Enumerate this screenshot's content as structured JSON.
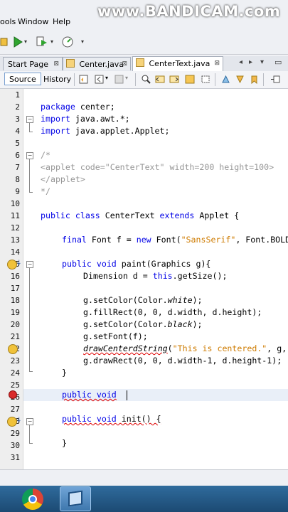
{
  "menu": {
    "items": [
      "ools",
      "Window",
      "Help"
    ]
  },
  "watermark": "www.BANDICAM.com",
  "tabs": [
    {
      "label": "Start Page",
      "close": "⊠"
    },
    {
      "label": "Center.java",
      "close": "⊠"
    },
    {
      "label": "CenterText.java",
      "close": "⊠"
    }
  ],
  "editor_toolbar": {
    "source_label": "Source",
    "history_label": "History"
  },
  "editor": {
    "line_numbers": [
      "1",
      "2",
      "3",
      "4",
      "5",
      "6",
      "7",
      "8",
      "9",
      "10",
      "11",
      "12",
      "13",
      "14",
      "15",
      "16",
      "17",
      "18",
      "19",
      "20",
      "21",
      "22",
      "23",
      "24",
      "25",
      "26",
      "27",
      "28",
      "29",
      "30",
      "31"
    ]
  },
  "code": {
    "l2_kw": "package",
    "l2_rest": " center;",
    "l3_kw": "import",
    "l3_rest": " java.awt.*;",
    "l4_kw": "import",
    "l4_rest": " java.applet.Applet;",
    "l7": "/*",
    "l8": "<applet code=\"CenterText\" width=200 height=100>",
    "l9": "</applet>",
    "l10": "*/",
    "l11_kw1": "public class",
    "l11_mid": " CenterText ",
    "l11_kw2": "extends",
    "l11_rest": " Applet {",
    "l13_kw1": "final",
    "l13_a": " Font f = ",
    "l13_kw2": "new",
    "l13_b": " Font(",
    "l13_str": "\"SansSerif\"",
    "l13_c": ", Font.BOLD",
    "l15_kw": "public void",
    "l15_rest": " paint(Graphics g){",
    "l16_a": "Dimension d = ",
    "l16_kw": "this",
    "l16_b": ".getSize();",
    "l18_a": "g.setColor(Color.",
    "l18_it": "white",
    "l18_b": ");",
    "l19": "g.fillRect(0, 0, d.width, d.height);",
    "l20_a": "g.setColor(Color.",
    "l20_it": "black",
    "l20_b": ");",
    "l21": "g.setFont(f);",
    "l22_a": "drawCenterdString",
    "l22_b": "(",
    "l22_str": "\"This is centered.\"",
    "l22_c": ", g, d",
    "l23": "g.drawRect(0, 0, d.width-1, d.height-1);",
    "l24": "}",
    "l26_kw": "public void",
    "l26_rest": " ",
    "l28_kw": "public void",
    "l28_rest": " init() {",
    "l30": "}"
  },
  "colors": {
    "keyword": "#0000e6",
    "string": "#ce7b00",
    "comment": "#969696",
    "error": "#e00000"
  }
}
